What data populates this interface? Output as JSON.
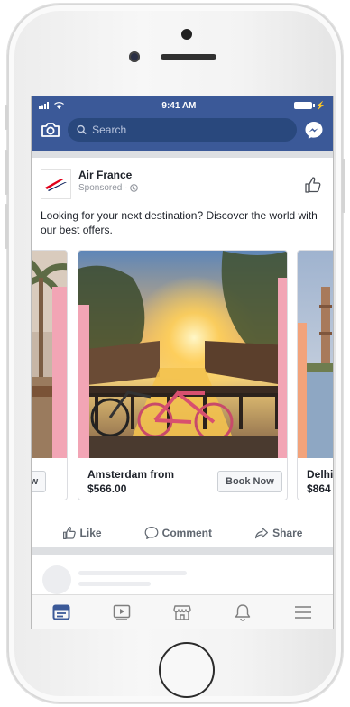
{
  "status_bar": {
    "time": "9:41 AM"
  },
  "header": {
    "search_placeholder": "Search"
  },
  "post": {
    "page_name": "Air France",
    "sponsored": "Sponsored · ",
    "text": "Looking for your next destination? Discover the world with our best offers.",
    "cards": [
      {
        "caption_line1": "",
        "caption_line2": "",
        "button": "Now"
      },
      {
        "caption_line1": "Amsterdam from",
        "caption_line2": "$566.00",
        "button": "Book Now"
      },
      {
        "caption_line1": "Delhi",
        "caption_line2": "$864",
        "button": ""
      }
    ],
    "actions": {
      "like": "Like",
      "comment": "Comment",
      "share": "Share"
    }
  },
  "colors": {
    "brand": "#3b5998",
    "search_bg": "#29487d",
    "air_france_red": "#e2001a",
    "feed_bg": "#dddfe2"
  },
  "icons": [
    "camera-icon",
    "search-icon",
    "messenger-icon",
    "thumbs-up-icon",
    "globe-icon",
    "comment-icon",
    "share-icon",
    "news-feed-icon",
    "video-icon",
    "marketplace-icon",
    "bell-icon",
    "menu-icon"
  ]
}
